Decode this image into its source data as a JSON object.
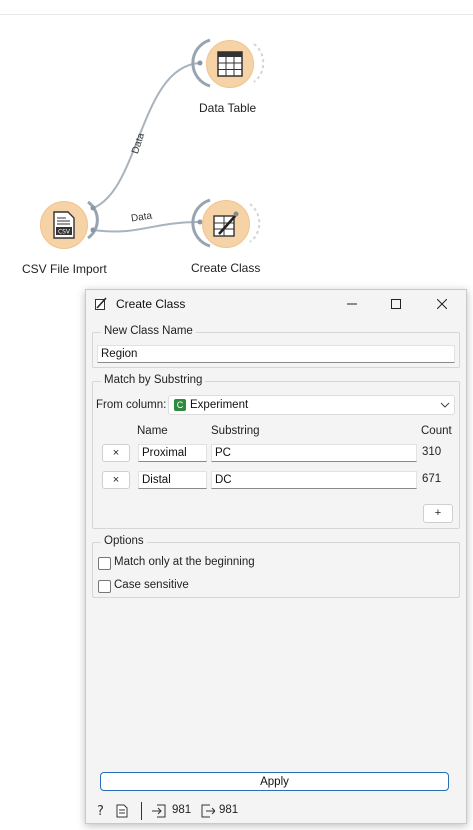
{
  "canvas": {
    "nodes": {
      "data_table": {
        "label": "Data Table",
        "icon": "data-table-icon"
      },
      "csv_import": {
        "label": "CSV File Import",
        "icon": "csv-file-icon",
        "icon_text": "CSV"
      },
      "create_class": {
        "label": "Create Class",
        "icon": "create-class-icon"
      }
    },
    "links": [
      {
        "label": "Data"
      },
      {
        "label": "Data"
      }
    ]
  },
  "dialog": {
    "title": "Create Class",
    "new_class": {
      "group_title": "New Class Name",
      "value": "Region"
    },
    "match": {
      "group_title": "Match by Substring",
      "from_column_label": "From column:",
      "column_chip": "C",
      "column_value": "Experiment",
      "headers": {
        "name": "Name",
        "substring": "Substring",
        "count": "Count"
      },
      "rows": [
        {
          "remove": "×",
          "name": "Proximal",
          "substring": "PC",
          "count": "310"
        },
        {
          "remove": "×",
          "name": "Distal",
          "substring": "DC",
          "count": "671"
        }
      ],
      "add_label": "+"
    },
    "options": {
      "group_title": "Options",
      "match_beginning": {
        "label": "Match only at the beginning",
        "checked": false
      },
      "case_sensitive": {
        "label": "Case sensitive",
        "checked": false
      }
    },
    "apply_label": "Apply",
    "status": {
      "input_count": "981",
      "output_count": "981"
    }
  },
  "colors": {
    "node_fill": "#f6d2a7",
    "link": "#a9b3bd",
    "accent": "#2a6fb5",
    "chip": "#2e8b3e"
  }
}
